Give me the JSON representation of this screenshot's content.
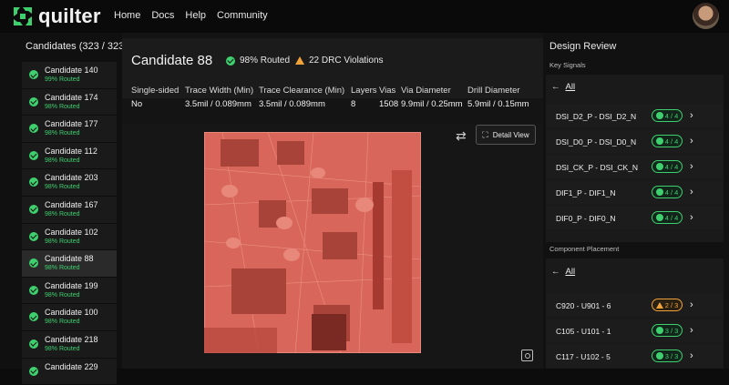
{
  "nav": {
    "logo": "quilter",
    "items": [
      "Home",
      "Docs",
      "Help",
      "Community"
    ]
  },
  "candidates": {
    "title": "Candidates (323 / 323)",
    "items": [
      {
        "name": "Candidate 140",
        "status": "99% Routed"
      },
      {
        "name": "Candidate 174",
        "status": "98% Routed"
      },
      {
        "name": "Candidate 177",
        "status": "98% Routed"
      },
      {
        "name": "Candidate 112",
        "status": "98% Routed"
      },
      {
        "name": "Candidate 203",
        "status": "98% Routed"
      },
      {
        "name": "Candidate 167",
        "status": "98% Routed"
      },
      {
        "name": "Candidate 102",
        "status": "98% Routed"
      },
      {
        "name": "Candidate 88",
        "status": "98% Routed"
      },
      {
        "name": "Candidate 199",
        "status": "98% Routed"
      },
      {
        "name": "Candidate 100",
        "status": "98% Routed"
      },
      {
        "name": "Candidate 218",
        "status": "98% Routed"
      },
      {
        "name": "Candidate 229",
        "status": ""
      }
    ],
    "selected_index": 7
  },
  "detail": {
    "title": "Candidate 88",
    "routed": "98% Routed",
    "drc": "22 DRC Violations",
    "spec_headers": [
      "Single-sided",
      "Trace Width (Min)",
      "Trace Clearance (Min)",
      "Layers",
      "Vias",
      "Via Diameter",
      "Drill Diameter"
    ],
    "spec_values": [
      "No",
      "3.5mil / 0.089mm",
      "3.5mil / 0.089mm",
      "8",
      "1508",
      "9.9mil / 0.25mm",
      "5.9mil / 0.15mm"
    ],
    "detail_view_label": "Detail View"
  },
  "review": {
    "title": "Design Review",
    "key_signals_label": "Key Signals",
    "all_label": "All",
    "signals": [
      {
        "name": "DSI_D2_P - DSI_D2_N",
        "badge": "4 / 4",
        "ok": true
      },
      {
        "name": "DSI_D0_P - DSI_D0_N",
        "badge": "4 / 4",
        "ok": true
      },
      {
        "name": "DSI_CK_P - DSI_CK_N",
        "badge": "4 / 4",
        "ok": true
      },
      {
        "name": "DIF1_P - DIF1_N",
        "badge": "4 / 4",
        "ok": true
      },
      {
        "name": "DIF0_P - DIF0_N",
        "badge": "4 / 4",
        "ok": true
      }
    ],
    "placement_label": "Component Placement",
    "placements": [
      {
        "name": "C920 - U901 - 6",
        "badge": "2 / 3",
        "ok": false
      },
      {
        "name": "C105 - U101 - 1",
        "badge": "3 / 3",
        "ok": true
      },
      {
        "name": "C117 - U102 - 5",
        "badge": "3 / 3",
        "ok": true
      }
    ]
  },
  "colors": {
    "accent_green": "#3ecf6e",
    "warning_orange": "#f0a23a",
    "board_red": "#d9665a"
  }
}
